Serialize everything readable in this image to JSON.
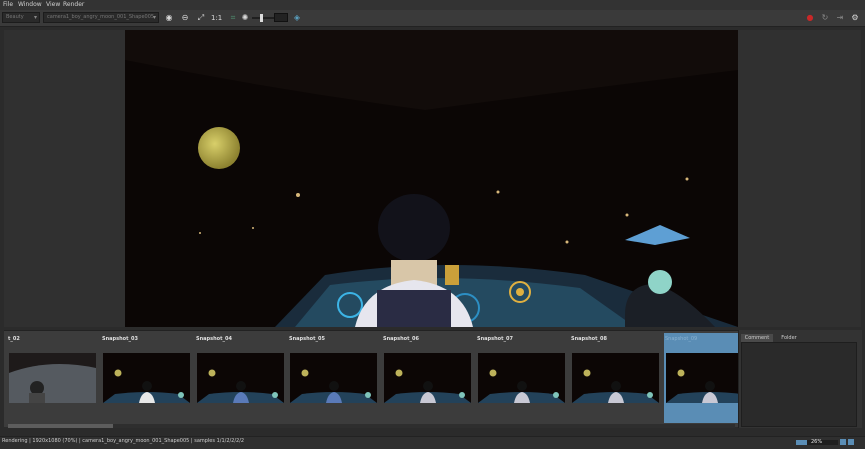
{
  "menu": [
    "File",
    "Window",
    "View",
    "Render"
  ],
  "toolbar": {
    "render_mode": "Beauty",
    "camera": "camera1_boy_angry_moon_001_Shape005",
    "zoom_label": "1:1",
    "exposure": 0.25
  },
  "snapshots": [
    {
      "label": "t_02",
      "variant": "color"
    },
    {
      "label": "Snapshot_03",
      "variant": "bright"
    },
    {
      "label": "Snapshot_04",
      "variant": "blue"
    },
    {
      "label": "Snapshot_05",
      "variant": "blue"
    },
    {
      "label": "Snapshot_06",
      "variant": "grey"
    },
    {
      "label": "Snapshot_07",
      "variant": "grey"
    },
    {
      "label": "Snapshot_08",
      "variant": "grey"
    },
    {
      "label": "Snapshot_09",
      "variant": "grey",
      "selected": true
    }
  ],
  "side_tabs": [
    "Comment",
    "Folder"
  ],
  "status": {
    "text": "Rendering | 1920x1080 (70%) | camera1_boy_angry_moon_001_Shape005 | samples 1/1/2/2/2/2",
    "progress_label": "26%",
    "progress": 0.26
  },
  "colors": {
    "accent": "#5a8db5",
    "background": "#2b2b2b",
    "record": "#c82828"
  }
}
